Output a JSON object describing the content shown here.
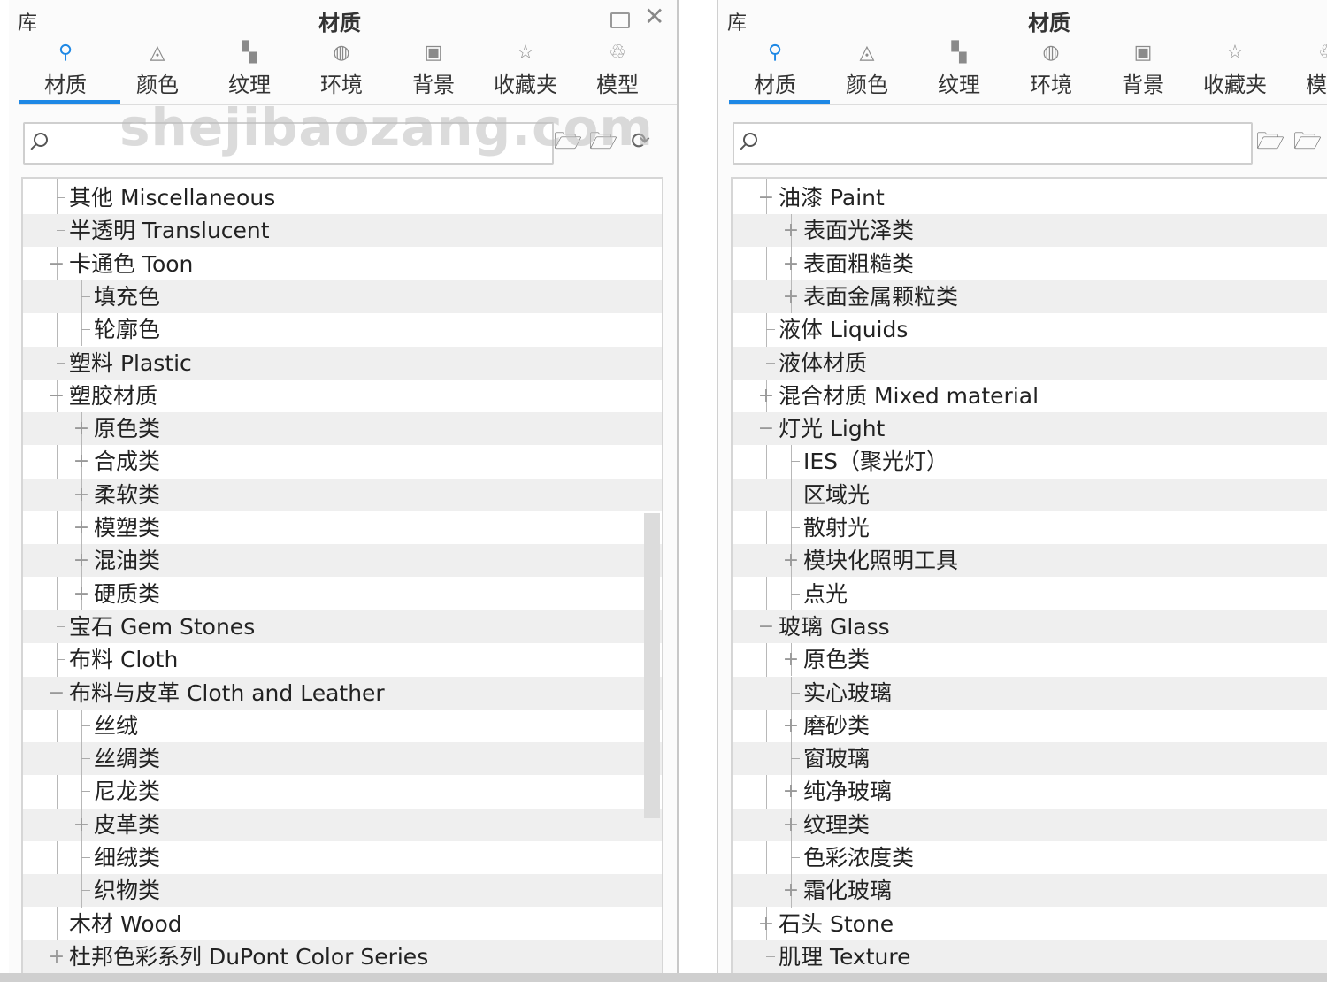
{
  "left_panel": {
    "library_label": "库",
    "title": "材质",
    "tabs": [
      {
        "label": "材质",
        "icon": "material-icon",
        "glyph": "⚲",
        "active": true
      },
      {
        "label": "颜色",
        "icon": "color-icon",
        "glyph": "◬",
        "active": false
      },
      {
        "label": "纹理",
        "icon": "texture-icon",
        "glyph": "▚",
        "active": false
      },
      {
        "label": "环境",
        "icon": "environment-icon",
        "glyph": "◍",
        "active": false
      },
      {
        "label": "背景",
        "icon": "background-icon",
        "glyph": "▣",
        "active": false
      },
      {
        "label": "收藏夹",
        "icon": "favorites-icon",
        "glyph": "☆",
        "active": false
      },
      {
        "label": "模型",
        "icon": "model-icon",
        "glyph": "♲",
        "active": false
      }
    ],
    "search_placeholder": "",
    "tree": [
      {
        "label": "其他 Miscellaneous",
        "level": 1,
        "exp": ""
      },
      {
        "label": "半透明 Translucent",
        "level": 1,
        "exp": ""
      },
      {
        "label": "卡通色 Toon",
        "level": 1,
        "exp": "−"
      },
      {
        "label": "填充色",
        "level": 2,
        "exp": ""
      },
      {
        "label": "轮廓色",
        "level": 2,
        "exp": ""
      },
      {
        "label": "塑料 Plastic",
        "level": 1,
        "exp": ""
      },
      {
        "label": "塑胶材质",
        "level": 1,
        "exp": "−"
      },
      {
        "label": "原色类",
        "level": 2,
        "exp": "+"
      },
      {
        "label": "合成类",
        "level": 2,
        "exp": "+"
      },
      {
        "label": "柔软类",
        "level": 2,
        "exp": "+"
      },
      {
        "label": "模塑类",
        "level": 2,
        "exp": "+"
      },
      {
        "label": "混油类",
        "level": 2,
        "exp": "+"
      },
      {
        "label": "硬质类",
        "level": 2,
        "exp": "+"
      },
      {
        "label": "宝石 Gem Stones",
        "level": 1,
        "exp": ""
      },
      {
        "label": "布料 Cloth",
        "level": 1,
        "exp": ""
      },
      {
        "label": "布料与皮革 Cloth and Leather",
        "level": 1,
        "exp": "−"
      },
      {
        "label": "丝绒",
        "level": 2,
        "exp": ""
      },
      {
        "label": "丝绸类",
        "level": 2,
        "exp": ""
      },
      {
        "label": "尼龙类",
        "level": 2,
        "exp": ""
      },
      {
        "label": "皮革类",
        "level": 2,
        "exp": "+"
      },
      {
        "label": "细绒类",
        "level": 2,
        "exp": ""
      },
      {
        "label": "织物类",
        "level": 2,
        "exp": ""
      },
      {
        "label": "木材 Wood",
        "level": 1,
        "exp": ""
      },
      {
        "label": "杜邦色彩系列 DuPont Color Series",
        "level": 1,
        "exp": "+"
      }
    ]
  },
  "right_panel": {
    "library_label": "库",
    "title": "材质",
    "tabs": [
      {
        "label": "材质",
        "icon": "material-icon",
        "glyph": "⚲",
        "active": true
      },
      {
        "label": "颜色",
        "icon": "color-icon",
        "glyph": "◬",
        "active": false
      },
      {
        "label": "纹理",
        "icon": "texture-icon",
        "glyph": "▚",
        "active": false
      },
      {
        "label": "环境",
        "icon": "environment-icon",
        "glyph": "◍",
        "active": false
      },
      {
        "label": "背景",
        "icon": "background-icon",
        "glyph": "▣",
        "active": false
      },
      {
        "label": "收藏夹",
        "icon": "favorites-icon",
        "glyph": "☆",
        "active": false
      },
      {
        "label": "模型",
        "icon": "model-icon",
        "glyph": "♲",
        "active": false
      }
    ],
    "search_placeholder": "",
    "tree": [
      {
        "label": "油漆 Paint",
        "level": 1,
        "exp": "−"
      },
      {
        "label": "表面光泽类",
        "level": 2,
        "exp": "+"
      },
      {
        "label": "表面粗糙类",
        "level": 2,
        "exp": "+"
      },
      {
        "label": "表面金属颗粒类",
        "level": 2,
        "exp": "+"
      },
      {
        "label": "液体 Liquids",
        "level": 1,
        "exp": ""
      },
      {
        "label": "液体材质",
        "level": 1,
        "exp": ""
      },
      {
        "label": "混合材质 Mixed material",
        "level": 1,
        "exp": "+"
      },
      {
        "label": "灯光 Light",
        "level": 1,
        "exp": "−"
      },
      {
        "label": "IES（聚光灯）",
        "level": 2,
        "exp": ""
      },
      {
        "label": "区域光",
        "level": 2,
        "exp": ""
      },
      {
        "label": "散射光",
        "level": 2,
        "exp": ""
      },
      {
        "label": "模块化照明工具",
        "level": 2,
        "exp": "+"
      },
      {
        "label": "点光",
        "level": 2,
        "exp": ""
      },
      {
        "label": "玻璃 Glass",
        "level": 1,
        "exp": "−"
      },
      {
        "label": "原色类",
        "level": 2,
        "exp": "+"
      },
      {
        "label": "实心玻璃",
        "level": 2,
        "exp": ""
      },
      {
        "label": "磨砂类",
        "level": 2,
        "exp": "+"
      },
      {
        "label": "窗玻璃",
        "level": 2,
        "exp": ""
      },
      {
        "label": "纯净玻璃",
        "level": 2,
        "exp": "+"
      },
      {
        "label": "纹理类",
        "level": 2,
        "exp": "+"
      },
      {
        "label": "色彩浓度类",
        "level": 2,
        "exp": ""
      },
      {
        "label": "霜化玻璃",
        "level": 2,
        "exp": "+"
      },
      {
        "label": "石头 Stone",
        "level": 1,
        "exp": "+"
      },
      {
        "label": "肌理 Texture",
        "level": 1,
        "exp": ""
      }
    ]
  },
  "watermark": "shejibaozang.com",
  "colors": {
    "accent": "#1e88e5",
    "row_alt": "#efefef"
  }
}
